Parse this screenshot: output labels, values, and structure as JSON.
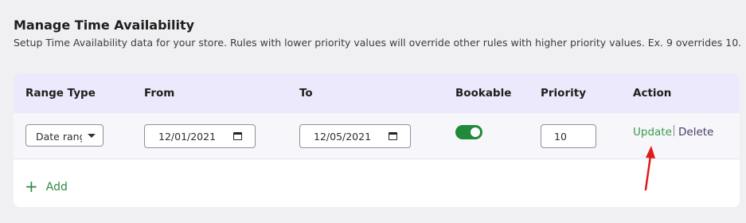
{
  "header": {
    "title": "Manage Time Availability",
    "description": "Setup Time Availability data for your store. Rules with lower priority values will override other rules with higher priority values. Ex. 9 overrides 10."
  },
  "table": {
    "columns": [
      "Range Type",
      "From",
      "To",
      "Bookable",
      "Priority",
      "Action"
    ],
    "rows": [
      {
        "range_type": "Date range",
        "from": "12/01/2021",
        "to": "12/05/2021",
        "bookable": true,
        "priority": "10",
        "update_label": "Update",
        "delete_label": "Delete"
      }
    ]
  },
  "add_label": "Add",
  "colors": {
    "header_bg": "#ede9fc",
    "toggle_on": "#1f8a3b",
    "update_link": "#3a9a4c",
    "add_link": "#2e8a45",
    "annotation_arrow": "#e01b1b"
  }
}
